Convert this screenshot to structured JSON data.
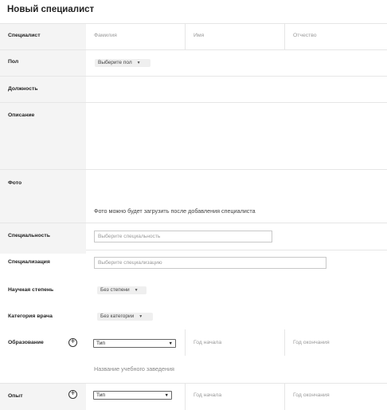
{
  "page": {
    "title": "Новый специалист"
  },
  "specialist": {
    "label": "Специалист",
    "last_name_placeholder": "Фамилия",
    "first_name_placeholder": "Имя",
    "patronymic_placeholder": "Отчество"
  },
  "gender": {
    "label": "Пол",
    "value": "Выберите пол"
  },
  "position": {
    "label": "Должность"
  },
  "description": {
    "label": "Описание"
  },
  "photo": {
    "label": "Фото",
    "note": "Фото можно будет загрузить после добавления специалиста"
  },
  "specialty": {
    "label": "Специальность",
    "placeholder": "Выберите специальность"
  },
  "specialization": {
    "label": "Специализация",
    "placeholder": "Выберите специализацию"
  },
  "degree": {
    "label": "Научная степень",
    "value": "Без степени"
  },
  "category": {
    "label": "Категория врача",
    "value": "Без категории"
  },
  "education": {
    "label": "Образование",
    "type_value": "Тип",
    "start_year_placeholder": "Год начала",
    "end_year_placeholder": "Год окончания",
    "institution_placeholder": "Название учебного заведения"
  },
  "experience": {
    "label": "Опыт",
    "type_value": "Тип",
    "start_year_placeholder": "Год начала",
    "end_year_placeholder": "Год окончания"
  }
}
